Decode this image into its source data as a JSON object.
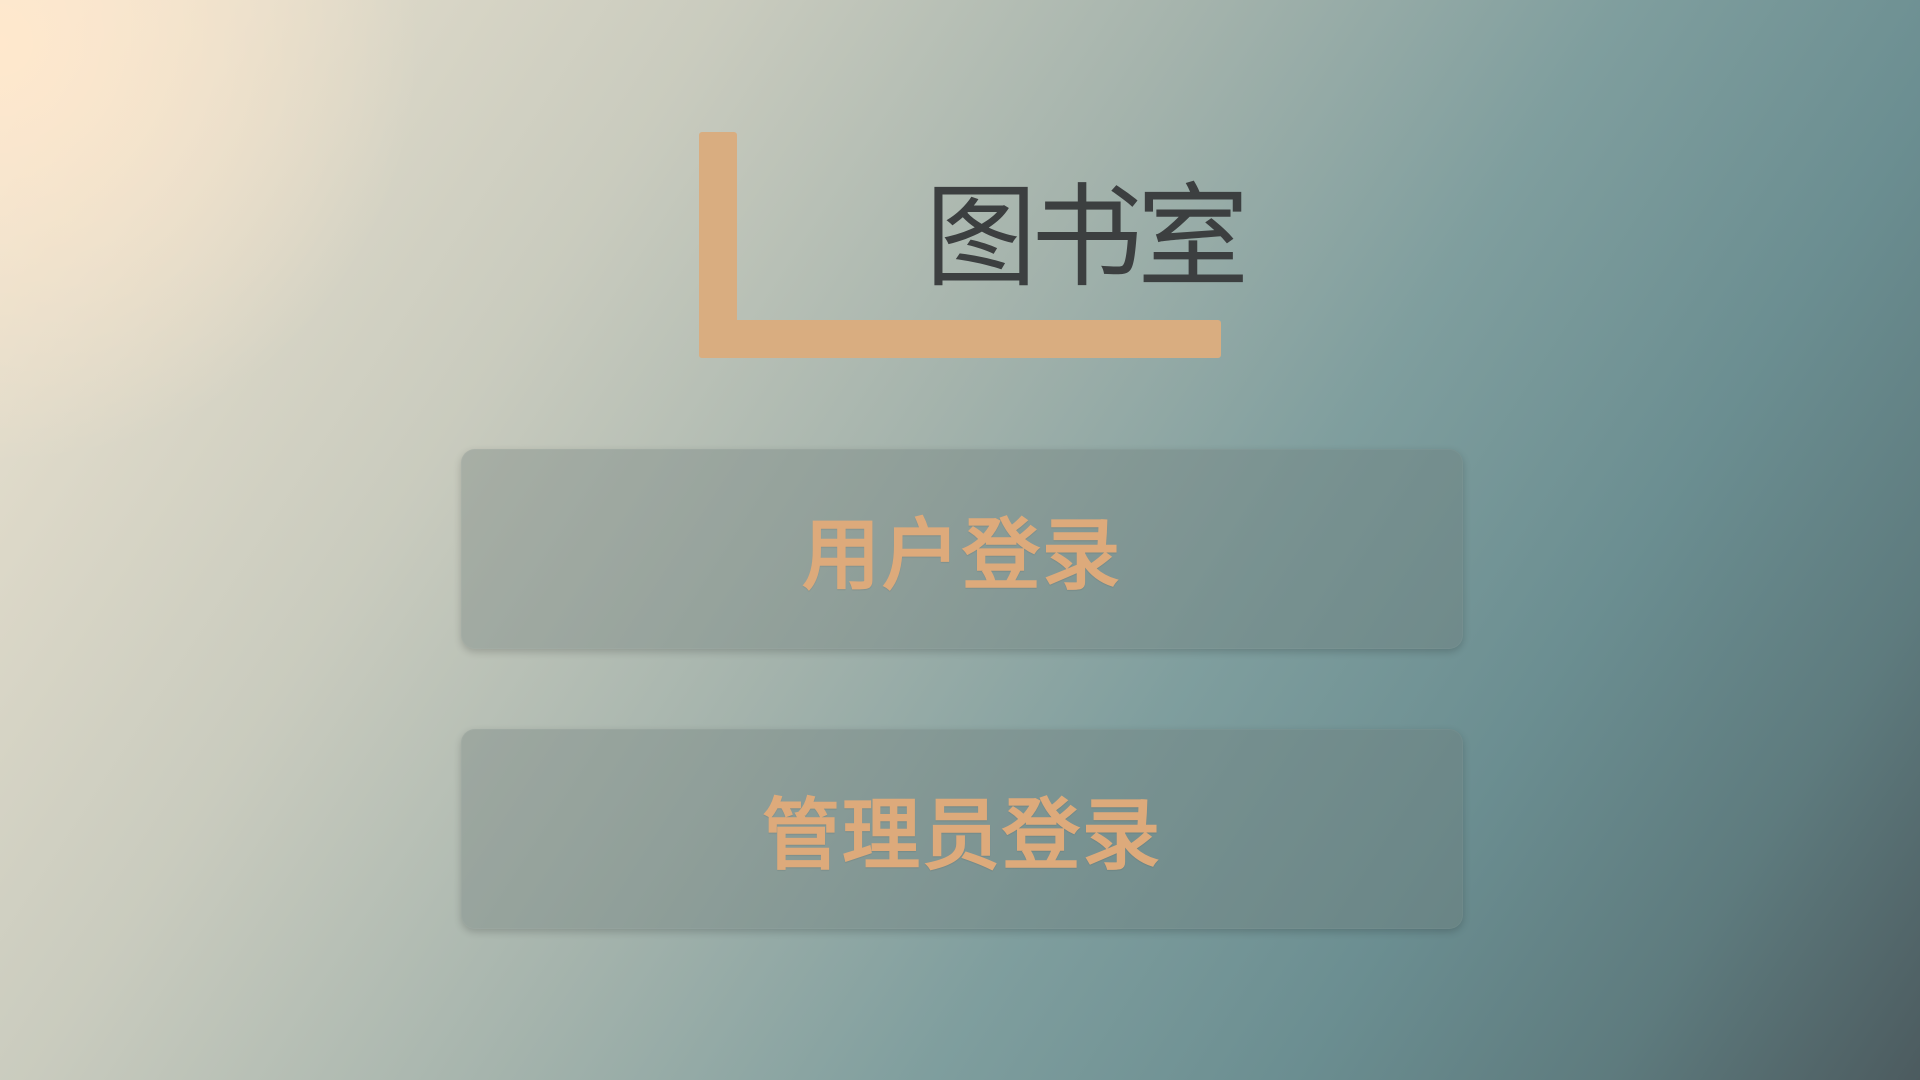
{
  "logo": {
    "title": "图书室",
    "books": [
      {
        "color": "#a09d88"
      },
      {
        "color": "#3b3b3b"
      },
      {
        "color": "#6e8f97"
      },
      {
        "color": "#9a3a2c"
      },
      {
        "color": "#e9e1d6"
      },
      {
        "color": "#6e97a4"
      }
    ],
    "shelf_color": "#d9ad80"
  },
  "buttons": {
    "user_login_label": "用户登录",
    "admin_login_label": "管理员登录"
  },
  "colors": {
    "button_text": "#ddaa7b",
    "title_text": "#3c3f40"
  }
}
